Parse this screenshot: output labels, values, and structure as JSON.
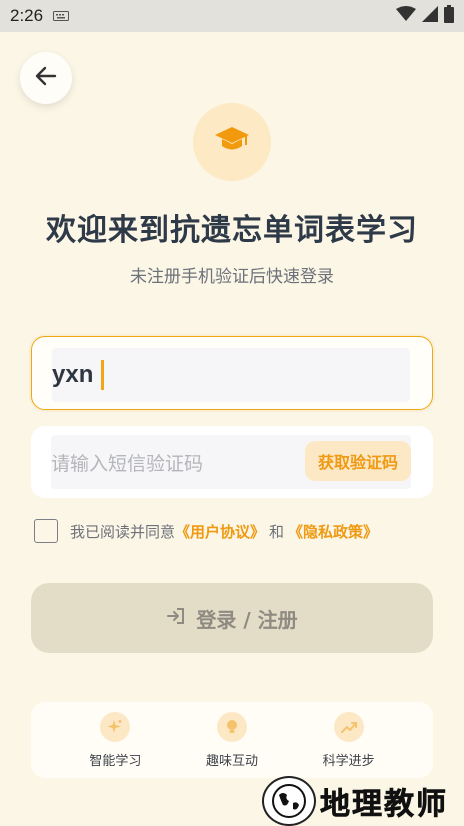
{
  "status_bar": {
    "time": "2:26",
    "keyboard_icon": "keyboard-icon",
    "wifi_icon": "wifi-icon",
    "signal_icon": "signal-icon",
    "battery_icon": "battery-icon"
  },
  "back_icon": "arrow-left-icon",
  "logo_icon": "graduation-cap-icon",
  "title": "欢迎来到抗遗忘单词表学习",
  "subtitle": "未注册手机验证后快速登录",
  "phone_input": {
    "value": "yxn"
  },
  "code_input": {
    "placeholder": "请输入短信验证码",
    "get_code_label": "获取验证码"
  },
  "agreement": {
    "prefix": "我已阅读并同意",
    "user_agreement": "《用户协议》",
    "and": "和",
    "privacy_policy": "《隐私政策》",
    "checked": false
  },
  "login_button": {
    "icon": "login-icon",
    "label": "登录 / 注册"
  },
  "features": [
    {
      "icon": "sparkle-icon",
      "label": "智能学习"
    },
    {
      "icon": "lightbulb-icon",
      "label": "趣味互动"
    },
    {
      "icon": "trend-up-icon",
      "label": "科学进步"
    }
  ],
  "watermark": {
    "text": "地理教师"
  },
  "colors": {
    "background": "#fbf6e6",
    "accent": "#ef9a12",
    "accent_border": "#f1a617",
    "accent_light": "#fde8c6",
    "title": "#2f3a48",
    "login_disabled_bg": "#e3dcc6"
  }
}
